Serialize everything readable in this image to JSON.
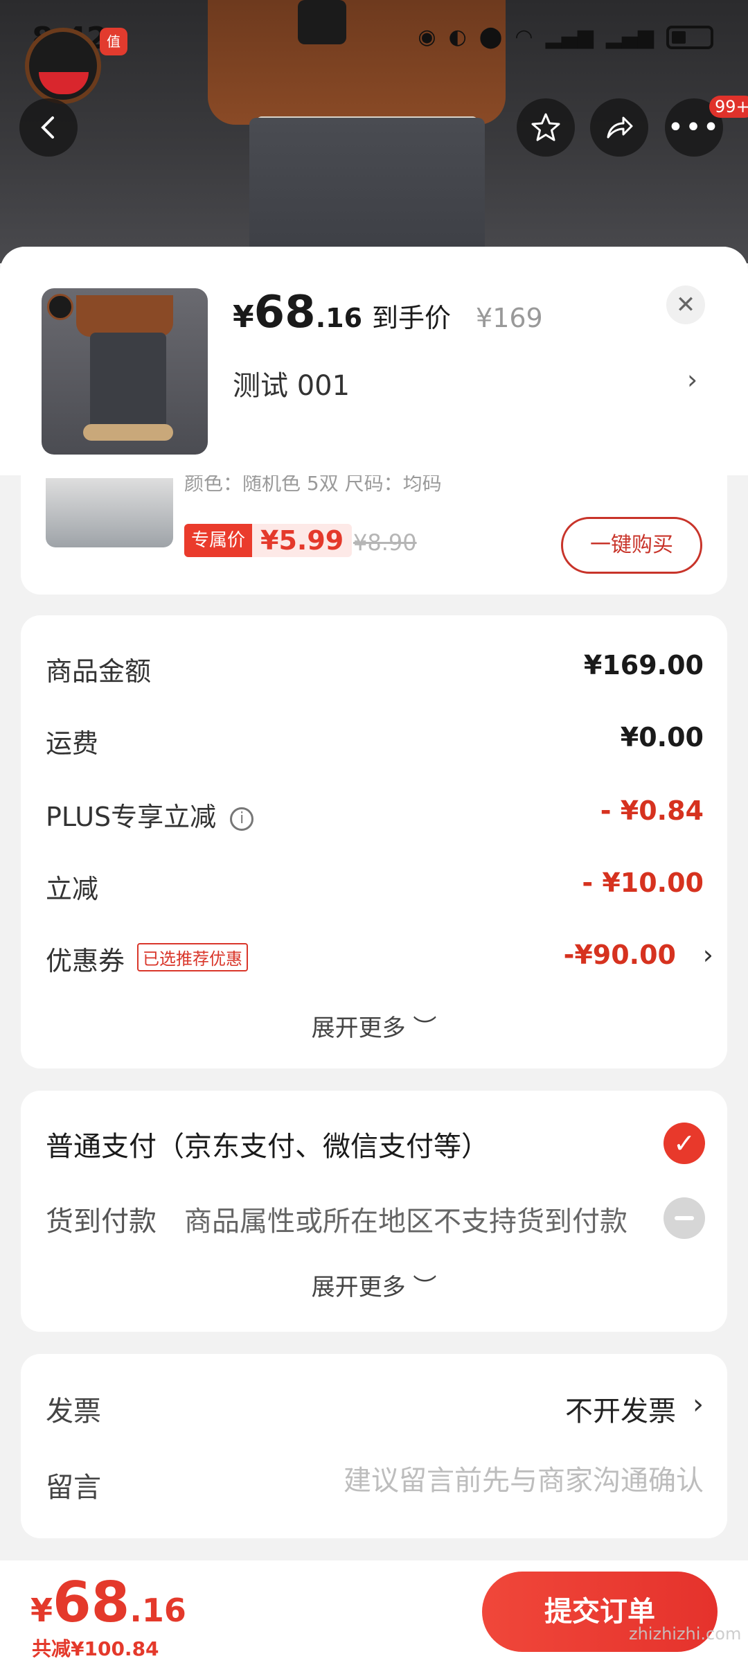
{
  "status_bar": {
    "time": "8:42"
  },
  "header": {
    "brand_badge": "值",
    "more_badge": "99+"
  },
  "product": {
    "price_currency": "¥",
    "price_int": "68",
    "price_dec": ".16",
    "price_label": "到手价",
    "original_price": "¥169",
    "spec": "测试  001"
  },
  "addon": {
    "spec": "颜色：随机色 5双   尺码：均码",
    "exclusive_label": "专属价",
    "exclusive_price": "¥5.99",
    "old_price": "¥8.90",
    "buy_button": "一键购买"
  },
  "summary": {
    "rows": [
      {
        "label": "商品金额",
        "value": "¥169.00"
      },
      {
        "label": "运费",
        "value": "¥0.00"
      },
      {
        "label": "PLUS专享立减",
        "value": "- ¥0.84"
      },
      {
        "label": "立减",
        "value": "- ¥10.00"
      },
      {
        "label": "优惠券",
        "value": "-¥90.00"
      }
    ],
    "coupon_tag": "已选推荐优惠",
    "expand": "展开更多 ︶"
  },
  "payment": {
    "normal": "普通支付（京东支付、微信支付等）",
    "cod": "货到付款",
    "cod_note": "商品属性或所在地区不支持货到付款",
    "expand": "展开更多 ︶"
  },
  "misc": {
    "invoice_label": "发票",
    "invoice_value": "不开发票",
    "message_label": "留言",
    "message_placeholder": "建议留言前先与商家沟通确认"
  },
  "footer": {
    "total_currency": "¥",
    "total_int": "68",
    "total_dec": ".16",
    "saved": "共减¥100.84",
    "submit": "提交订单",
    "watermark": "zhizhizhi.com"
  }
}
